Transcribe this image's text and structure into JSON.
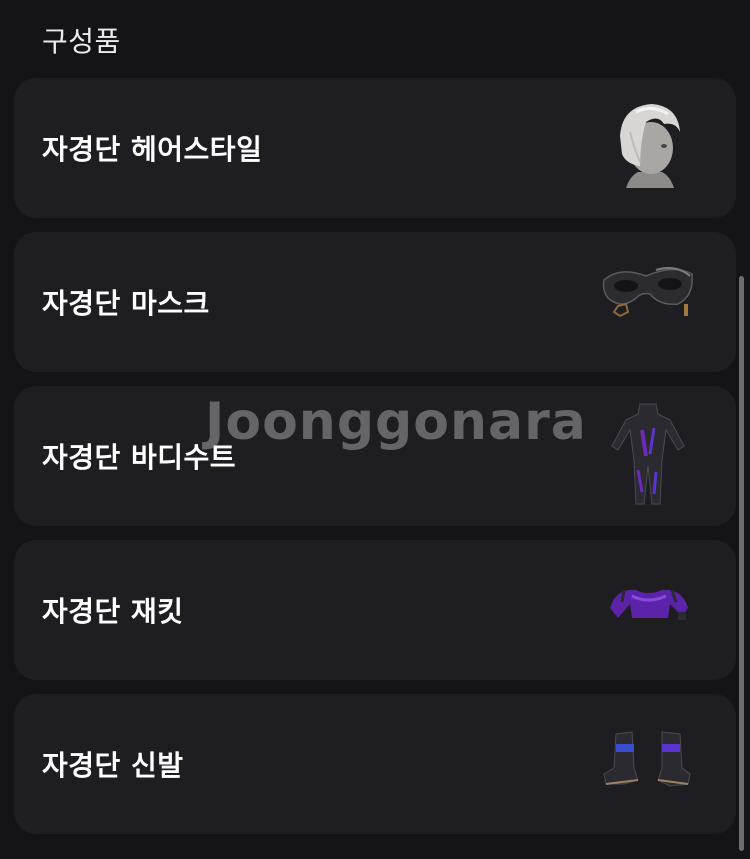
{
  "section": {
    "title": "구성품"
  },
  "items": [
    {
      "label": "자경단 헤어스타일",
      "icon": "hairstyle-icon"
    },
    {
      "label": "자경단 마스크",
      "icon": "mask-icon"
    },
    {
      "label": "자경단 바디수트",
      "icon": "bodysuit-icon"
    },
    {
      "label": "자경단 재킷",
      "icon": "jacket-icon"
    },
    {
      "label": "자경단 신발",
      "icon": "shoes-icon"
    }
  ],
  "watermark": "Joonggonara",
  "colors": {
    "background": "#141416",
    "card": "#1e1e22",
    "accent_purple": "#6a2bb8"
  }
}
